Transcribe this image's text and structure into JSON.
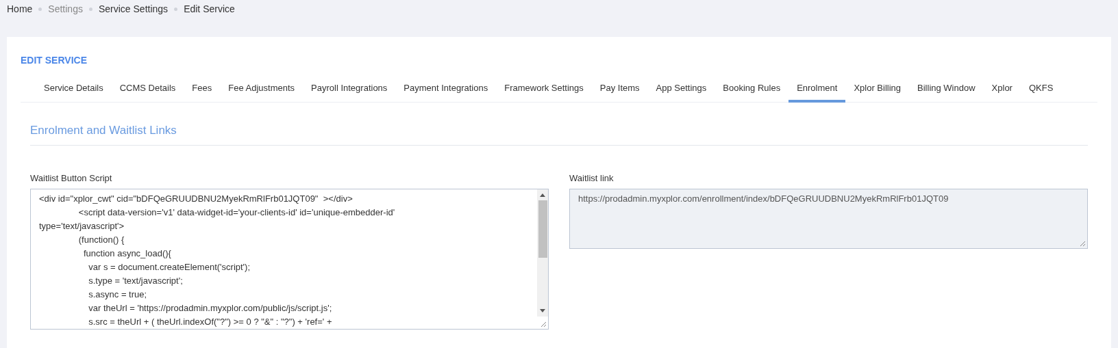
{
  "breadcrumb": [
    {
      "label": "Home",
      "muted": false
    },
    {
      "label": "Settings",
      "muted": true
    },
    {
      "label": "Service Settings",
      "muted": false
    },
    {
      "label": "Edit Service",
      "muted": false
    }
  ],
  "page_title": "EDIT SERVICE",
  "tabs": [
    {
      "label": "Service Details",
      "selected": false
    },
    {
      "label": "CCMS Details",
      "selected": false
    },
    {
      "label": "Fees",
      "selected": false
    },
    {
      "label": "Fee Adjustments",
      "selected": false
    },
    {
      "label": "Payroll Integrations",
      "selected": false
    },
    {
      "label": "Payment Integrations",
      "selected": false
    },
    {
      "label": "Framework Settings",
      "selected": false
    },
    {
      "label": "Pay Items",
      "selected": false
    },
    {
      "label": "App Settings",
      "selected": false
    },
    {
      "label": "Booking Rules",
      "selected": false
    },
    {
      "label": "Enrolment",
      "selected": true
    },
    {
      "label": "Xplor Billing",
      "selected": false
    },
    {
      "label": "Billing Window",
      "selected": false
    },
    {
      "label": "Xplor",
      "selected": false
    },
    {
      "label": "QKFS",
      "selected": false
    }
  ],
  "section_title": "Enrolment and Waitlist Links",
  "script_field": {
    "label": "Waitlist Button Script",
    "lines": [
      "<div id=\"xplor_cwt\" cid=\"bDFQeGRUUDBNU2MyekRmRlFrb01JQT09\"  ></div>",
      "                <script data-version='v1' data-widget-id='your-clients-id' id='unique-embedder-id'",
      "type='text/javascript'>",
      "                (function() {",
      "                  function async_load(){",
      "                    var s = document.createElement('script');",
      "                    s.type = 'text/javascript';",
      "                    s.async = true;",
      "                    var theUrl = 'https://prodadmin.myxplor.com/public/js/script.js';",
      "                    s.src = theUrl + ( theUrl.indexOf(\"?\") >= 0 ? \"&\" : \"?\") + 'ref=' +"
    ]
  },
  "link_field": {
    "label": "Waitlist link",
    "value": "https://prodadmin.myxplor.com/enrollment/index/bDFQeGRUUDBNU2MyekRmRlFrb01JQT09",
    "readonly": true
  }
}
